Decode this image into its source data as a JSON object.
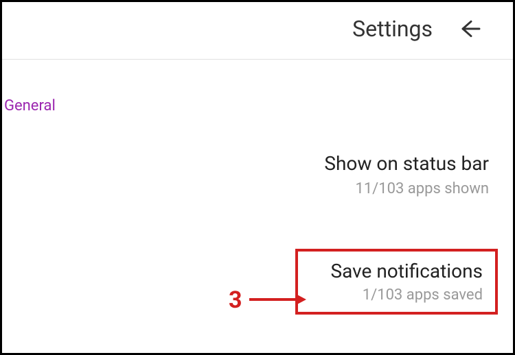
{
  "header": {
    "title": "Settings"
  },
  "section": {
    "label": "General"
  },
  "items": {
    "statusBar": {
      "title": "Show on status bar",
      "subtitle": "11/103 apps shown"
    },
    "saveNotifications": {
      "title": "Save notifications",
      "subtitle": "1/103 apps saved"
    }
  },
  "annotation": {
    "number": "3"
  }
}
